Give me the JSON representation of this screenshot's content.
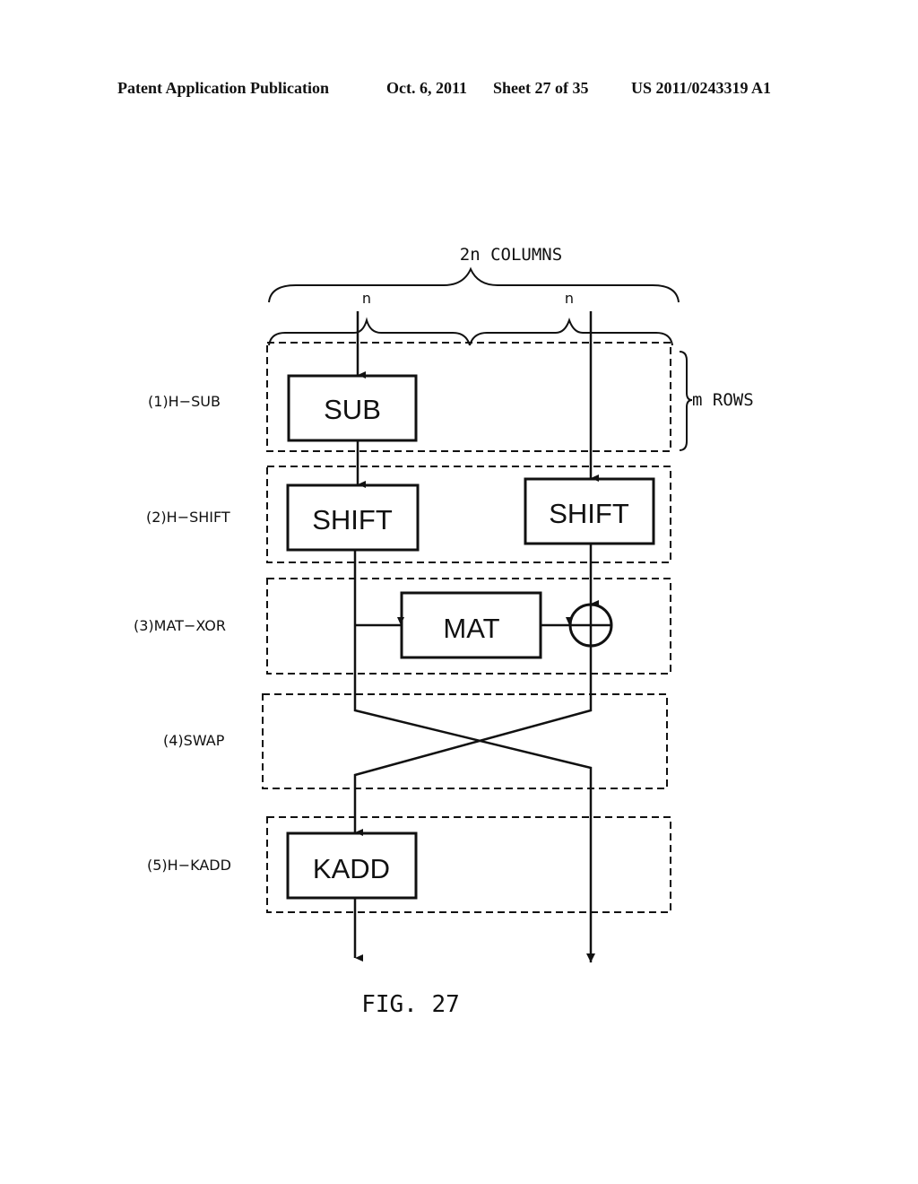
{
  "header": {
    "publication": "Patent Application Publication",
    "date": "Oct. 6, 2011",
    "sheet": "Sheet 27 of 35",
    "number": "US 2011/0243319 A1"
  },
  "diagram": {
    "columns_label": "2n COLUMNS",
    "half_left_label": "n",
    "half_right_label": "n",
    "rows_label": "m ROWS",
    "stages": [
      {
        "label": "(1)H−SUB"
      },
      {
        "label": "(2)H−SHIFT"
      },
      {
        "label": "(3)MAT−XOR"
      },
      {
        "label": "(4)SWAP"
      },
      {
        "label": "(5)H−KADD"
      }
    ],
    "blocks": {
      "sub": "SUB",
      "shift_left": "SHIFT",
      "shift_right": "SHIFT",
      "mat": "MAT",
      "kadd": "KADD"
    },
    "xor_symbol": "xor-circle-plus"
  },
  "figure_caption": "FIG. 27"
}
